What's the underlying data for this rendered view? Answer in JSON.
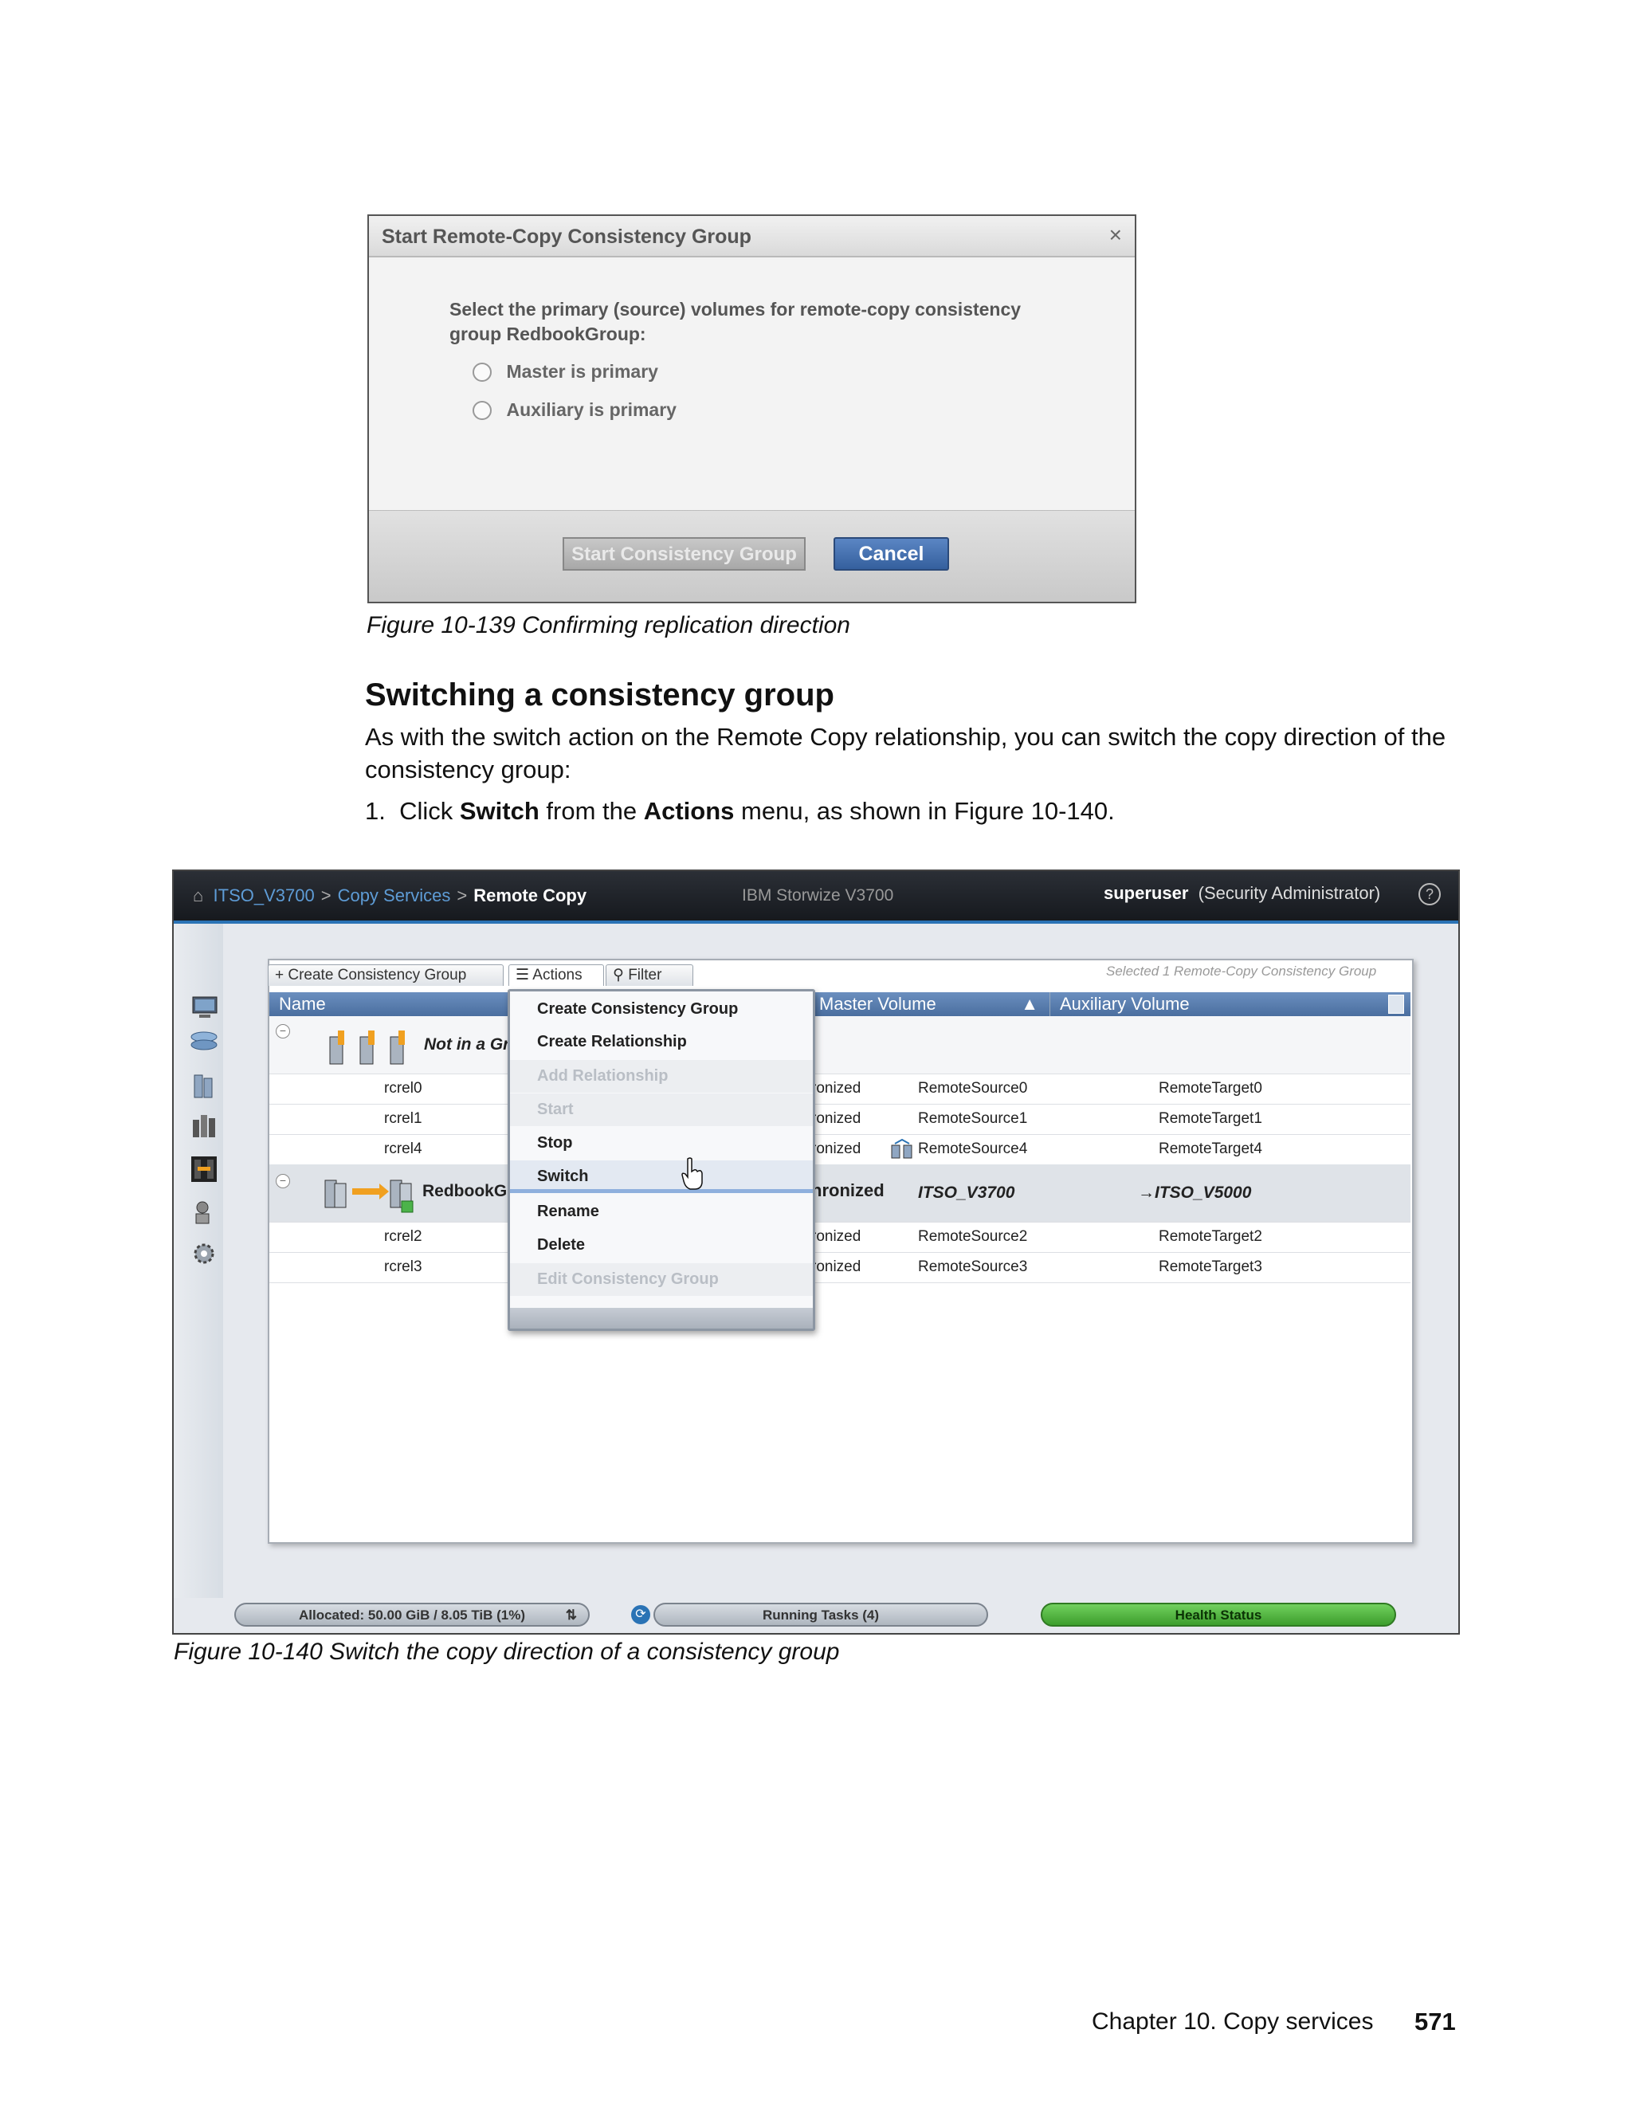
{
  "figure1": {
    "dialog_title": "Start Remote-Copy Consistency Group",
    "close_glyph": "×",
    "prompt": "Select the primary (source) volumes for remote-copy consistency group RedbookGroup:",
    "options": [
      "Master is primary",
      "Auxiliary is primary"
    ],
    "start_button": "Start Consistency Group",
    "cancel_button": "Cancel",
    "caption": "Figure 10-139   Confirming replication direction"
  },
  "section": {
    "heading": "Switching a consistency group",
    "paragraph": "As with the switch action on the Remote Copy relationship, you can switch the copy direction of the consistency group:",
    "step_number": "1.",
    "step_pre": "Click ",
    "step_switch": "Switch",
    "step_mid": " from the ",
    "step_actions": "Actions",
    "step_post": " menu, as shown in Figure 10-140."
  },
  "figure2": {
    "breadcrumb": [
      "ITSO_V3700",
      "Copy Services",
      "Remote Copy"
    ],
    "breadcrumb_sep": ">",
    "product": "IBM Storwize V3700",
    "user_name": "superuser",
    "user_role": "(Security Administrator)",
    "help_glyph": "?",
    "tabs": {
      "create": "+ Create Consistency Group",
      "actions": "Actions",
      "filter": "Filter"
    },
    "selected_note": "Selected 1 Remote-Copy Consistency Group",
    "columns": [
      "Name",
      "Master Volume",
      "Auxiliary Volume"
    ],
    "group1_label": "Not in a Gr",
    "group2_label": "RedbookG",
    "group2_state": "hronized",
    "group2_master": "ITSO_V3700",
    "group2_aux": "→ITSO_V5000",
    "rows_group1": [
      {
        "name": "rcrel0",
        "state": "ronized",
        "master": "RemoteSource0",
        "aux": "RemoteTarget0"
      },
      {
        "name": "rcrel1",
        "state": "ronized",
        "master": "RemoteSource1",
        "aux": "RemoteTarget1"
      },
      {
        "name": "rcrel4",
        "state": "ronized",
        "master": "RemoteSource4",
        "aux": "RemoteTarget4"
      }
    ],
    "rows_group2": [
      {
        "name": "rcrel2",
        "state": "ronized",
        "master": "RemoteSource2",
        "aux": "RemoteTarget2"
      },
      {
        "name": "rcrel3",
        "state": "ronized",
        "master": "RemoteSource3",
        "aux": "RemoteTarget3"
      }
    ],
    "menu": [
      {
        "label": "Create Consistency Group",
        "enabled": true
      },
      {
        "label": "Create Relationship",
        "enabled": true
      },
      {
        "label": "Add Relationship",
        "enabled": false
      },
      {
        "label": "Start",
        "enabled": false
      },
      {
        "label": "Stop",
        "enabled": true
      },
      {
        "label": "Switch",
        "enabled": true
      },
      {
        "label": "Rename",
        "enabled": true
      },
      {
        "label": "Delete",
        "enabled": true
      },
      {
        "label": "Edit Consistency Group",
        "enabled": false
      }
    ],
    "status": {
      "allocated": "Allocated: 50.00 GiB / 8.05 TiB (1%)",
      "tasks": "Running Tasks (4)",
      "health": "Health Status"
    },
    "caption": "Figure 10-140   Switch the copy direction of a consistency group"
  },
  "footer": {
    "chapter": "Chapter 10. Copy services",
    "page": "571"
  }
}
